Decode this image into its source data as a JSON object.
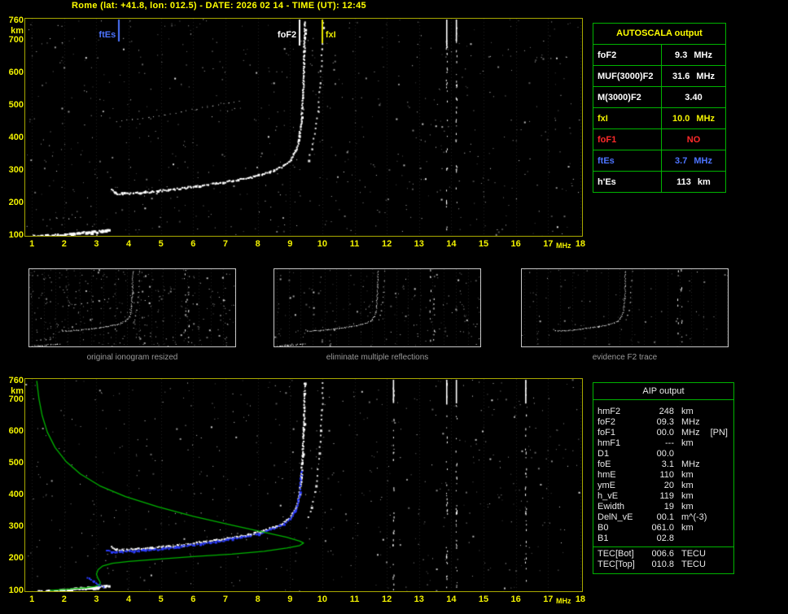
{
  "title": "Rome (lat: +41.8, lon: 012.5) - DATE: 2026 02 14 - TIME (UT): 12:45",
  "autoscala_table": {
    "title": "AUTOSCALA output",
    "rows": [
      {
        "label": "foF2",
        "value": "9.3",
        "unit": "MHz",
        "color": "#ffffff"
      },
      {
        "label": "MUF(3000)F2",
        "value": "31.6",
        "unit": "MHz",
        "color": "#ffffff"
      },
      {
        "label": "M(3000)F2",
        "value": "3.40",
        "unit": "",
        "color": "#ffffff"
      },
      {
        "label": "fxI",
        "value": "10.0",
        "unit": "MHz",
        "color": "#f2f200"
      },
      {
        "label": "foF1",
        "value": "NO",
        "unit": "",
        "color": "#ff2a2a"
      },
      {
        "label": "ftEs",
        "value": "3.7",
        "unit": "MHz",
        "color": "#4d74ff"
      },
      {
        "label": "h'Es",
        "value": "113",
        "unit": "km",
        "color": "#ffffff"
      }
    ]
  },
  "aip_table": {
    "title": "AIP output",
    "rows": [
      {
        "name": "hmF2",
        "value": "248",
        "unit": "km",
        "extra": ""
      },
      {
        "name": "foF2",
        "value": "09.3",
        "unit": "MHz",
        "extra": ""
      },
      {
        "name": "foF1",
        "value": "00.0",
        "unit": "MHz",
        "extra": "[PN]"
      },
      {
        "name": "hmF1",
        "value": "---",
        "unit": "km",
        "extra": ""
      },
      {
        "name": "D1",
        "value": "00.0",
        "unit": "",
        "extra": ""
      },
      {
        "name": "foE",
        "value": "3.1",
        "unit": "MHz",
        "extra": ""
      },
      {
        "name": "hmE",
        "value": "110",
        "unit": "km",
        "extra": ""
      },
      {
        "name": "ymE",
        "value": "20",
        "unit": "km",
        "extra": ""
      },
      {
        "name": "h_vE",
        "value": "119",
        "unit": "km",
        "extra": ""
      },
      {
        "name": "Ewidth",
        "value": "19",
        "unit": "km",
        "extra": ""
      },
      {
        "name": "DelN_vE",
        "value": "00.1",
        "unit": "m^(-3)",
        "extra": ""
      },
      {
        "name": "B0",
        "value": "061.0",
        "unit": "km",
        "extra": ""
      },
      {
        "name": "B1",
        "value": "02.8",
        "unit": "",
        "extra": ""
      }
    ],
    "tec_rows": [
      {
        "name": "TEC[Bot]",
        "value": "006.6",
        "unit": "TECU"
      },
      {
        "name": "TEC[Top]",
        "value": "010.8",
        "unit": "TECU"
      }
    ]
  },
  "thumbnails": [
    {
      "caption": "original ionogram resized",
      "noise": 320,
      "series": [
        "Es-layer-trace",
        "Es-echo",
        "F2-o-trace",
        "F2-x-trace",
        "second-hop-echo"
      ]
    },
    {
      "caption": "eliminate multiple reflections",
      "noise": 170,
      "series": [
        "Es-layer-trace",
        "F2-o-trace",
        "F2-x-trace"
      ]
    },
    {
      "caption": "evidence F2 trace",
      "noise": 70,
      "series": [
        "F2-o-trace",
        "F2-x-trace"
      ]
    }
  ],
  "chart_data": [
    {
      "type": "scatter",
      "title": "ionogram with autoscaled characteristics",
      "xlabel": "MHz",
      "ylabel": "km",
      "xlim": [
        1,
        18
      ],
      "ylim": [
        100,
        760
      ],
      "x_ticks": [
        1,
        2,
        3,
        4,
        5,
        6,
        7,
        8,
        9,
        10,
        11,
        12,
        13,
        14,
        15,
        16,
        17,
        18
      ],
      "y_ticks": [
        760,
        700,
        600,
        500,
        400,
        300,
        200,
        100
      ],
      "grid": "dotted-vertical",
      "markers": [
        {
          "label": "ftEs",
          "x": 3.7,
          "color": "#4d74ff",
          "label_side": "left",
          "line_len": 28
        },
        {
          "label": "foF2",
          "x": 9.3,
          "color": "#ffffff",
          "label_side": "left",
          "line_len": 33
        },
        {
          "label": "fxI",
          "x": 10.0,
          "color": "#e6e600",
          "label_side": "right",
          "line_len": 30
        }
      ],
      "interference_lines": [
        13.85,
        14.15
      ],
      "noise_dots": 650,
      "series": [
        {
          "name": "Es-layer-trace",
          "color": "#ffffff",
          "style": "dots",
          "thickness": 3,
          "points": [
            [
              1.05,
              97
            ],
            [
              1.45,
              99
            ],
            [
              1.85,
              101
            ],
            [
              2.2,
              104
            ],
            [
              2.55,
              108
            ],
            [
              2.9,
              111
            ],
            [
              3.15,
              113
            ],
            [
              3.35,
              115
            ]
          ]
        },
        {
          "name": "Es-echo",
          "color": "#cccccc",
          "style": "sparse",
          "thickness": 1,
          "points": [
            [
              1.35,
              148
            ],
            [
              1.75,
              152
            ],
            [
              2.15,
              151
            ],
            [
              2.5,
              156
            ]
          ]
        },
        {
          "name": "F2-o-trace",
          "color": "#ffffff",
          "style": "dots",
          "thickness": 2,
          "points": [
            [
              3.45,
              240
            ],
            [
              3.6,
              229
            ],
            [
              3.8,
              228
            ],
            [
              4.2,
              231
            ],
            [
              4.7,
              234
            ],
            [
              5.2,
              239
            ],
            [
              5.7,
              245
            ],
            [
              6.2,
              252
            ],
            [
              6.7,
              259
            ],
            [
              7.2,
              267
            ],
            [
              7.7,
              276
            ],
            [
              8.1,
              287
            ],
            [
              8.5,
              300
            ],
            [
              8.8,
              315
            ],
            [
              9.0,
              333
            ],
            [
              9.15,
              358
            ],
            [
              9.25,
              392
            ],
            [
              9.32,
              442
            ],
            [
              9.37,
              520
            ],
            [
              9.41,
              620
            ],
            [
              9.44,
              755
            ]
          ]
        },
        {
          "name": "F2-x-trace",
          "color": "#e0e0e0",
          "style": "sparse",
          "thickness": 2,
          "points": [
            [
              9.55,
              330
            ],
            [
              9.65,
              365
            ],
            [
              9.75,
              410
            ],
            [
              9.85,
              480
            ],
            [
              9.92,
              570
            ],
            [
              9.97,
              670
            ],
            [
              10.0,
              755
            ]
          ]
        },
        {
          "name": "second-hop-echo",
          "color": "#cccccc",
          "style": "sparse",
          "thickness": 1,
          "points": [
            [
              3.6,
              448
            ],
            [
              4.1,
              455
            ],
            [
              4.6,
              462
            ],
            [
              5.1,
              470
            ],
            [
              5.6,
              478
            ],
            [
              6.1,
              487
            ],
            [
              6.6,
              497
            ],
            [
              7.1,
              507
            ],
            [
              7.4,
              514
            ]
          ]
        }
      ]
    },
    {
      "type": "scatter",
      "title": "ionogram with fitted trace and electron density profile",
      "xlabel": "MHz",
      "ylabel": "km",
      "xlim": [
        1,
        18
      ],
      "ylim": [
        100,
        760
      ],
      "x_ticks": [
        1,
        2,
        3,
        4,
        5,
        6,
        7,
        8,
        9,
        10,
        11,
        12,
        13,
        14,
        15,
        16,
        17,
        18
      ],
      "y_ticks": [
        760,
        700,
        600,
        500,
        400,
        300,
        200,
        100
      ],
      "grid": "dotted-vertical",
      "interference_lines": [
        12.2,
        13.85,
        14.15,
        16.3
      ],
      "noise_dots": 520,
      "series": [
        {
          "name": "Es-layer-trace",
          "color": "#ffffff",
          "style": "dots",
          "thickness": 3,
          "points": [
            [
              1.05,
              97
            ],
            [
              1.45,
              99
            ],
            [
              1.85,
              101
            ],
            [
              2.2,
              104
            ],
            [
              2.55,
              108
            ],
            [
              2.9,
              111
            ],
            [
              3.15,
              113
            ],
            [
              3.35,
              115
            ]
          ]
        },
        {
          "name": "F2-o-trace",
          "color": "#ffffff",
          "style": "dots",
          "thickness": 2,
          "points": [
            [
              3.45,
              240
            ],
            [
              3.6,
              229
            ],
            [
              3.8,
              228
            ],
            [
              4.2,
              231
            ],
            [
              4.7,
              234
            ],
            [
              5.2,
              239
            ],
            [
              5.7,
              245
            ],
            [
              6.2,
              252
            ],
            [
              6.7,
              259
            ],
            [
              7.2,
              267
            ],
            [
              7.7,
              276
            ],
            [
              8.1,
              287
            ],
            [
              8.5,
              300
            ],
            [
              8.8,
              315
            ],
            [
              9.0,
              333
            ],
            [
              9.15,
              358
            ],
            [
              9.25,
              392
            ],
            [
              9.32,
              442
            ],
            [
              9.37,
              520
            ],
            [
              9.41,
              620
            ],
            [
              9.44,
              755
            ]
          ]
        },
        {
          "name": "F2-x-trace",
          "color": "#e0e0e0",
          "style": "sparse",
          "thickness": 2,
          "points": [
            [
              9.55,
              330
            ],
            [
              9.65,
              365
            ],
            [
              9.75,
              410
            ],
            [
              9.85,
              480
            ],
            [
              9.92,
              570
            ],
            [
              9.97,
              670
            ],
            [
              10.0,
              755
            ]
          ]
        },
        {
          "name": "fitted-trace-F2",
          "color": "#2b3cff",
          "style": "dots",
          "thickness": 2,
          "points": [
            [
              3.3,
              227
            ],
            [
              3.6,
              221
            ],
            [
              4.0,
              224
            ],
            [
              4.5,
              227
            ],
            [
              5.0,
              231
            ],
            [
              5.5,
              237
            ],
            [
              6.0,
              244
            ],
            [
              6.5,
              251
            ],
            [
              7.0,
              259
            ],
            [
              7.5,
              268
            ],
            [
              8.0,
              279
            ],
            [
              8.4,
              292
            ],
            [
              8.8,
              309
            ],
            [
              9.0,
              327
            ],
            [
              9.15,
              352
            ],
            [
              9.25,
              388
            ],
            [
              9.3,
              432
            ],
            [
              9.33,
              475
            ]
          ]
        },
        {
          "name": "fitted-trace-E",
          "color": "#2b3cff",
          "style": "dots",
          "thickness": 2,
          "points": [
            [
              2.7,
              142
            ],
            [
              2.9,
              128
            ],
            [
              3.05,
              118
            ],
            [
              3.2,
              112
            ]
          ]
        },
        {
          "name": "electron-density-profile",
          "color": "#00b400",
          "style": "line",
          "thickness": 1,
          "points": [
            [
              1.15,
              758
            ],
            [
              1.22,
              700
            ],
            [
              1.32,
              648
            ],
            [
              1.48,
              596
            ],
            [
              1.72,
              548
            ],
            [
              2.05,
              505
            ],
            [
              2.5,
              465
            ],
            [
              3.1,
              428
            ],
            [
              3.9,
              394
            ],
            [
              4.9,
              362
            ],
            [
              6.0,
              332
            ],
            [
              7.1,
              306
            ],
            [
              8.1,
              284
            ],
            [
              8.9,
              266
            ],
            [
              9.3,
              254
            ],
            [
              9.42,
              248
            ],
            [
              9.3,
              240
            ],
            [
              8.9,
              232
            ],
            [
              8.2,
              222
            ],
            [
              7.2,
              213
            ],
            [
              6.0,
              205
            ],
            [
              4.9,
              197
            ],
            [
              4.0,
              190
            ],
            [
              3.5,
              184
            ],
            [
              3.2,
              176
            ],
            [
              3.05,
              164
            ],
            [
              3.0,
              150
            ],
            [
              3.05,
              136
            ],
            [
              3.12,
              124
            ],
            [
              3.1,
              116
            ],
            [
              2.95,
              111
            ],
            [
              2.7,
              107
            ],
            [
              2.3,
              104
            ],
            [
              1.9,
              101
            ],
            [
              1.55,
              99
            ]
          ]
        }
      ]
    }
  ]
}
